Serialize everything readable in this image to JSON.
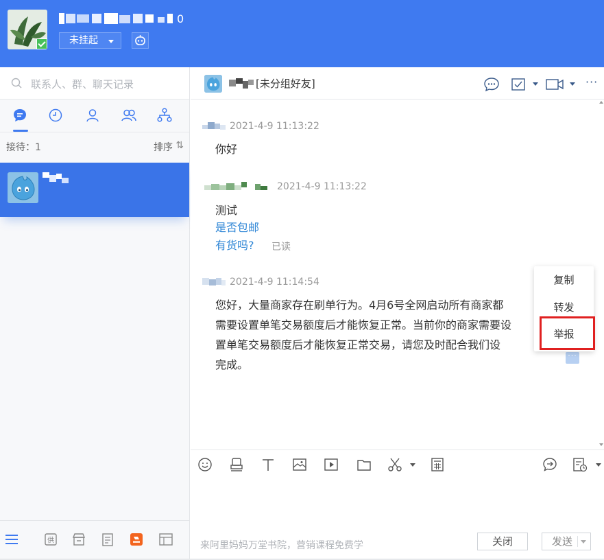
{
  "header": {
    "status_label": "未挂起",
    "icons": [
      "avatar",
      "verified-check-icon",
      "robot-icon"
    ]
  },
  "sidebar": {
    "search_placeholder": "联系人、群、聊天记录",
    "tabs": [
      "chat-icon",
      "recent-icon",
      "contact-icon",
      "group-icon",
      "org-icon"
    ],
    "reception_label": "接待：1",
    "sort_label": "排序",
    "sort_icon": "⇅",
    "bottom_icons": [
      "menu-icon",
      "supply-icon",
      "shop-icon",
      "note-icon",
      "app-icon",
      "window-icon"
    ]
  },
  "chat": {
    "group_label": "[未分组好友]",
    "header_icons": [
      "chat-bubble-icon",
      "task-icon",
      "video-icon",
      "more-icon"
    ],
    "more_label": "···",
    "messages": [
      {
        "time": "2021-4-9 11:13:22",
        "text": "你好"
      },
      {
        "time": "2021-4-9 11:13:22",
        "lines": [
          "测试",
          "是否包邮",
          "有货吗?"
        ],
        "read_label": "已读"
      },
      {
        "time": "2021-4-9 11:14:54",
        "lines": [
          "您好，大量商家存在刷单行为。4月6号全网启动所有商家都",
          "需要设置单笔交易额度后才能恢复正常。当前你的商家需要设",
          "置单笔交易额度后才能恢复正常交易，请您及时配合我们设",
          "完成。"
        ]
      }
    ],
    "context_menu": [
      "复制",
      "转发",
      "举报"
    ],
    "more_dots": "···"
  },
  "input": {
    "toolbar_icons": [
      "emoji-icon",
      "stamp-icon",
      "text-icon",
      "image-icon",
      "video-play-icon",
      "folder-icon",
      "scissors-icon",
      "calculator-icon",
      "quick-reply-icon",
      "history-icon"
    ],
    "promo_text": "来阿里妈妈万堂书院，营销课程免费学",
    "close_label": "关闭",
    "send_label": "发送"
  },
  "colors": {
    "brand_blue": "#3f7af0",
    "selected_row": "#3a74e8",
    "link_blue": "#2f86d6",
    "highlight_red": "#e02020"
  }
}
